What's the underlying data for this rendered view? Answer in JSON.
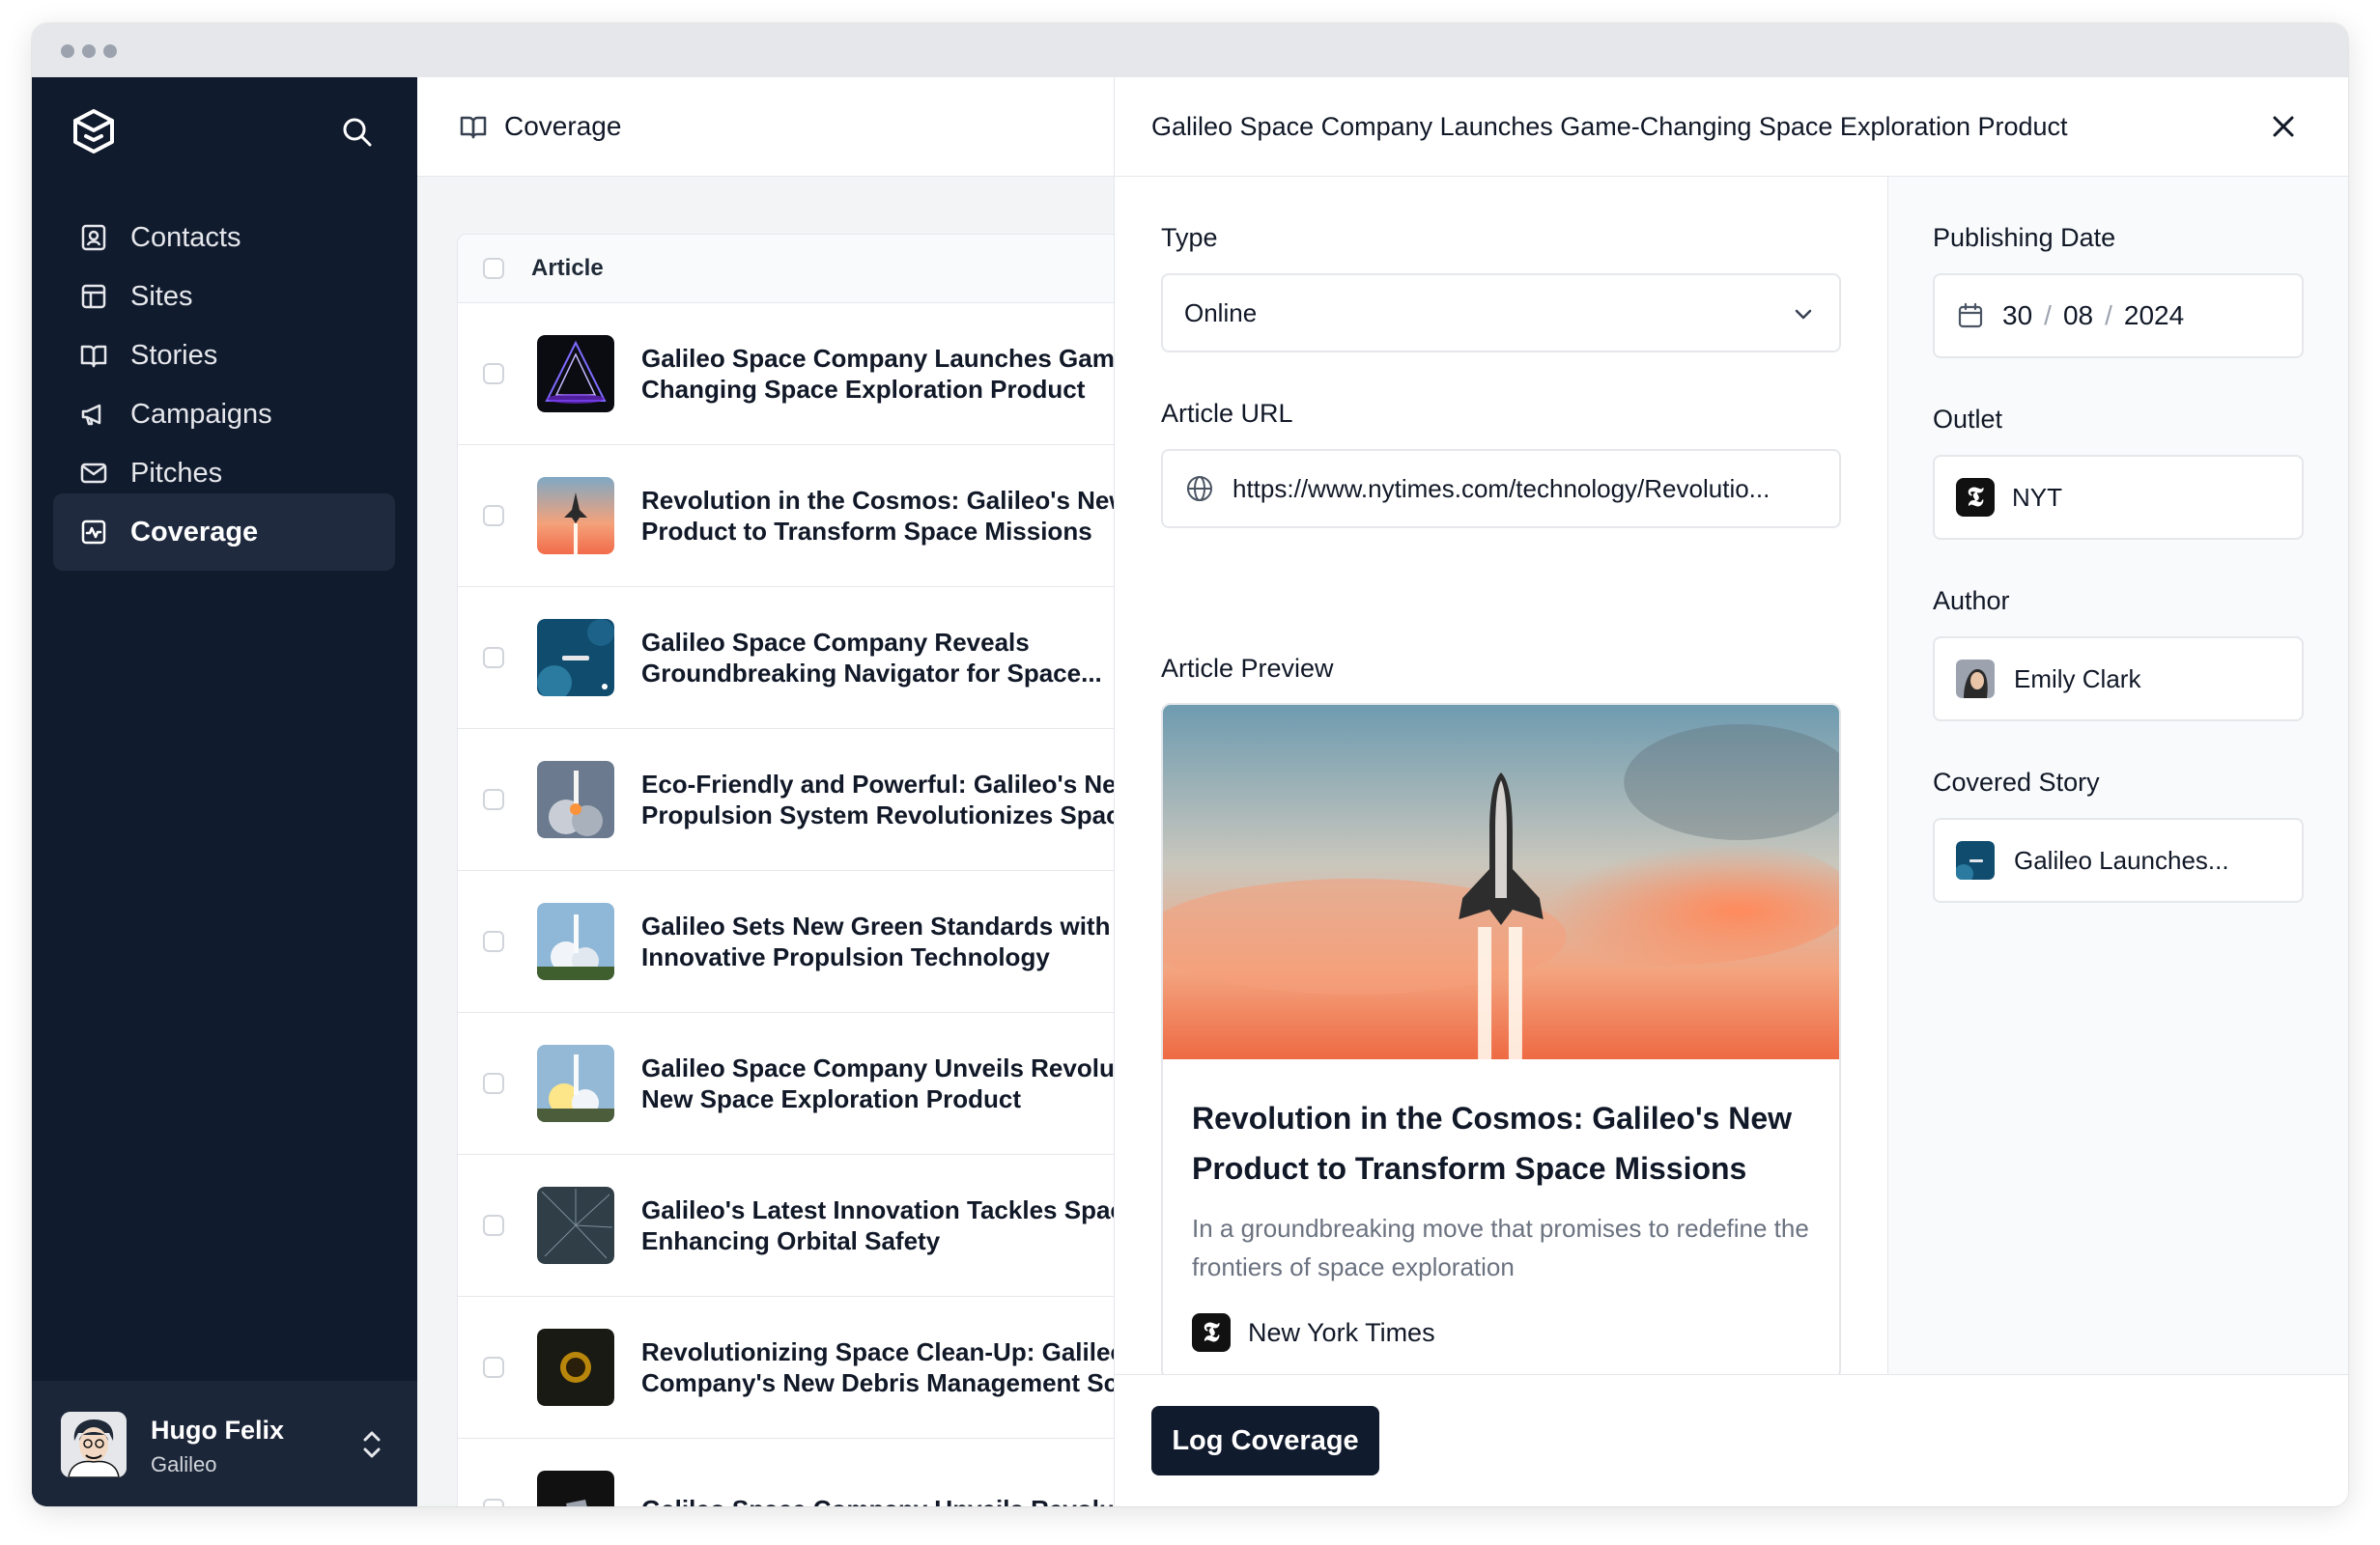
{
  "sidebar": {
    "items": [
      {
        "label": "Contacts",
        "icon": "contact-card-icon"
      },
      {
        "label": "Sites",
        "icon": "layout-icon"
      },
      {
        "label": "Stories",
        "icon": "book-open-icon"
      },
      {
        "label": "Campaigns",
        "icon": "megaphone-icon"
      },
      {
        "label": "Pitches",
        "icon": "mail-icon"
      },
      {
        "label": "Coverage",
        "icon": "chart-icon",
        "active": true
      }
    ],
    "user": {
      "name": "Hugo Felix",
      "org": "Galileo"
    }
  },
  "list": {
    "header_title": "Coverage",
    "column_article": "Article",
    "rows": [
      {
        "line1": "Galileo Space Company Launches Game-",
        "line2": "Changing Space Exploration Product"
      },
      {
        "line1": "Revolution in the Cosmos: Galileo's New",
        "line2": "Product to Transform Space Missions"
      },
      {
        "line1": "Galileo Space Company Reveals",
        "line2": "Groundbreaking Navigator for Space..."
      },
      {
        "line1": "Eco-Friendly and Powerful: Galileo's New",
        "line2": "Propulsion System Revolutionizes Space"
      },
      {
        "line1": "Galileo Sets New Green Standards with",
        "line2": "Innovative Propulsion Technology"
      },
      {
        "line1": "Galileo Space Company Unveils Revolutionary",
        "line2": "New Space Exploration Product"
      },
      {
        "line1": "Galileo's Latest Innovation Tackles Space",
        "line2": "Enhancing Orbital Safety"
      },
      {
        "line1": "Revolutionizing Space Clean-Up: Galileo",
        "line2": "Company's New Debris Management Sc"
      },
      {
        "line1": "Galileo Space Company Unveils Revolutionary",
        "line2": ""
      }
    ]
  },
  "panel": {
    "title": "Galileo Space Company Launches Game-Changing Space Exploration Product",
    "type_label": "Type",
    "type_value": "Online",
    "url_label": "Article URL",
    "url_value": "https://www.nytimes.com/technology/Revolutio...",
    "preview_label": "Article Preview",
    "preview": {
      "title": "Revolution in the Cosmos: Galileo's New Product to Transform Space Missions",
      "description": "In a groundbreaking move that promises to redefine the frontiers of space exploration",
      "outlet": "New York Times"
    },
    "date_label": "Publishing Date",
    "date": {
      "day": "30",
      "month": "08",
      "year": "2024"
    },
    "outlet_label": "Outlet",
    "outlet_value": "NYT",
    "author_label": "Author",
    "author_value": "Emily Clark",
    "story_label": "Covered Story",
    "story_value": "Galileo Launches...",
    "submit_label": "Log Coverage"
  }
}
